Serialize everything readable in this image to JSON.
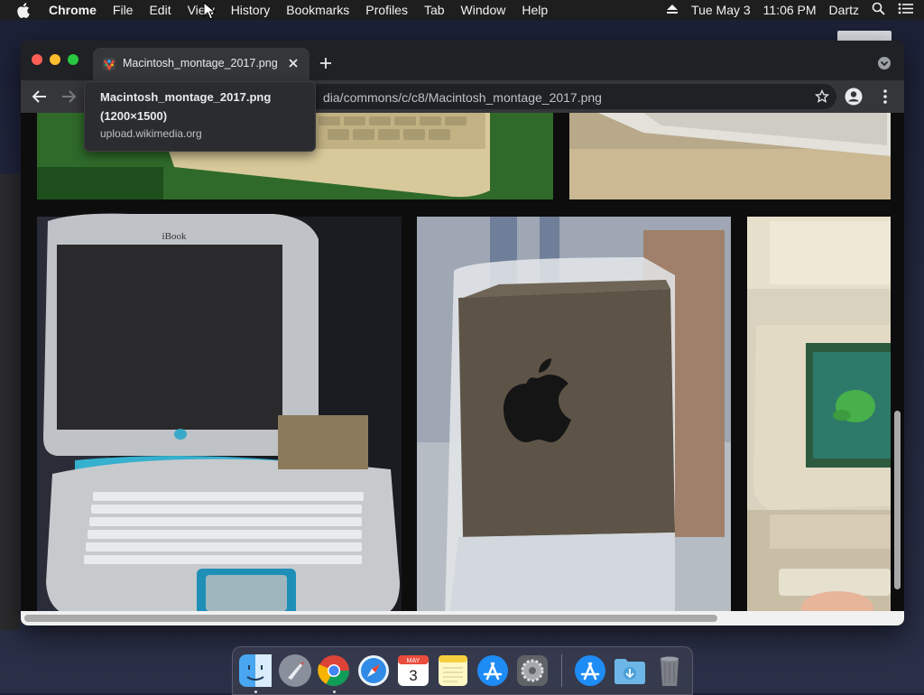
{
  "menubar": {
    "app_name": "Chrome",
    "items": [
      "File",
      "Edit",
      "View",
      "History",
      "Bookmarks",
      "Profiles",
      "Tab",
      "Window",
      "Help"
    ],
    "date": "Tue May 3",
    "time": "11:06 PM",
    "user": "Dartz"
  },
  "browser": {
    "tab_title": "Macintosh_montage_2017.png",
    "url_host_fragment": "",
    "url_rest": "dia/commons/c/c8/Macintosh_montage_2017.png"
  },
  "tooltip": {
    "title": "Macintosh_montage_2017.png",
    "dimensions": "(1200×1500)",
    "host": "upload.wikimedia.org"
  },
  "image_content": {
    "ibook_brand": "iBook"
  },
  "dock": {
    "apps": [
      "finder-icon",
      "launchpad-icon",
      "chrome-icon",
      "safari-icon",
      "calendar-icon",
      "notes-icon",
      "app-store-icon",
      "system-preferences-icon",
      "app-store-icon-2",
      "downloads-folder-icon",
      "trash-icon"
    ],
    "calendar_month": "MAY",
    "calendar_day": "3"
  },
  "colors": {
    "menubar": "#1e1e1e",
    "tab_active": "#35363a",
    "window_frame": "#202124"
  }
}
